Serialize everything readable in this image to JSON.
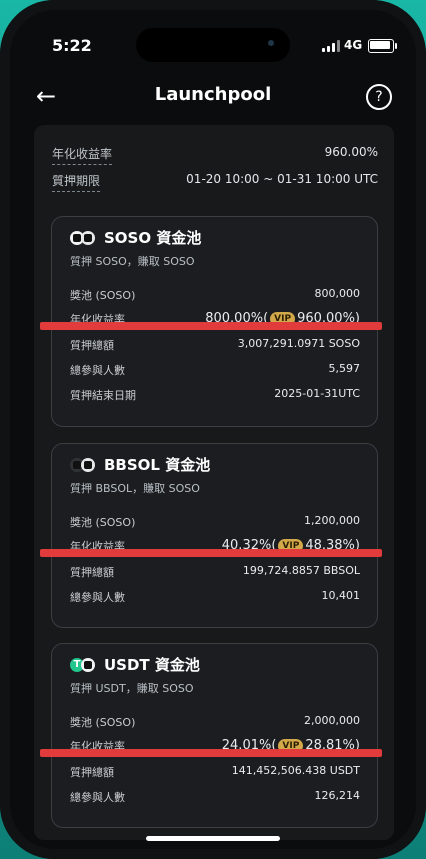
{
  "status": {
    "time": "5:22",
    "network": "4G"
  },
  "nav": {
    "title": "Launchpool"
  },
  "summary": {
    "apr_label": "年化收益率",
    "apr_value": "960.00%",
    "period_label": "質押期限",
    "period_value": "01-20 10:00 ~ 01-31 10:00 UTC"
  },
  "pools": [
    {
      "title": "SOSO 資金池",
      "subtitle": "質押 SOSO，賺取 SOSO",
      "rows": [
        {
          "label": "獎池 (SOSO)",
          "value": "800,000"
        },
        {
          "label": "年化收益率",
          "apr": "800.00%",
          "vip_apr": "960.00%"
        },
        {
          "label": "質押總額",
          "value": "3,007,291.0971 SOSO"
        },
        {
          "label": "總參與人數",
          "value": "5,597"
        },
        {
          "label": "質押結束日期",
          "value": "2025-01-31UTC"
        }
      ]
    },
    {
      "title": "BBSOL 資金池",
      "subtitle": "質押 BBSOL，賺取 SOSO",
      "rows": [
        {
          "label": "獎池 (SOSO)",
          "value": "1,200,000"
        },
        {
          "label": "年化收益率",
          "apr": "40.32%",
          "vip_apr": "48.38%"
        },
        {
          "label": "質押總額",
          "value": "199,724.8857 BBSOL"
        },
        {
          "label": "總參與人數",
          "value": "10,401"
        }
      ]
    },
    {
      "title": "USDT 資金池",
      "subtitle": "質押 USDT，賺取 SOSO",
      "rows": [
        {
          "label": "獎池 (SOSO)",
          "value": "2,000,000"
        },
        {
          "label": "年化收益率",
          "apr": "24.01%",
          "vip_apr": "28.81%"
        },
        {
          "label": "質押總額",
          "value": "141,452,506.438 USDT"
        },
        {
          "label": "總參與人數",
          "value": "126,214"
        }
      ]
    }
  ],
  "vip_label": "VIP"
}
